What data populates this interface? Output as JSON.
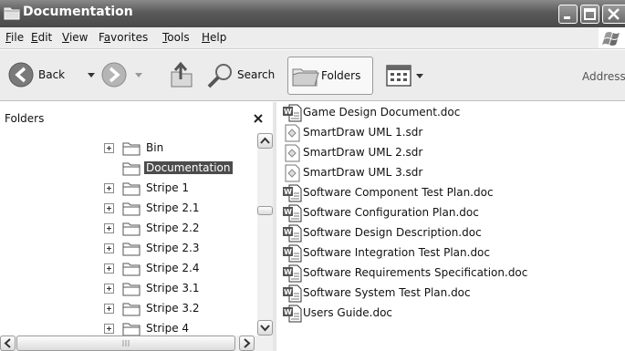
{
  "window": {
    "title": "Documentation"
  },
  "menu": [
    {
      "label": "File",
      "u": "F",
      "rest": "ile"
    },
    {
      "label": "Edit",
      "u": "E",
      "rest": "dit"
    },
    {
      "label": "View",
      "u": "V",
      "rest": "iew"
    },
    {
      "label": "Favorites",
      "pre": "F",
      "u": "a",
      "rest": "vorites"
    },
    {
      "label": "Tools",
      "u": "T",
      "rest": "ools"
    },
    {
      "label": "Help",
      "u": "H",
      "rest": "elp"
    }
  ],
  "toolbar": {
    "back_label": "Back",
    "search_label": "Search",
    "folders_label": "Folders",
    "address_label": "Address"
  },
  "folder_pane": {
    "header": "Folders",
    "items": [
      {
        "label": "Bin",
        "expandable": true,
        "selected": false
      },
      {
        "label": "Documentation",
        "expandable": false,
        "selected": true
      },
      {
        "label": "Stripe 1",
        "expandable": true,
        "selected": false
      },
      {
        "label": "Stripe 2.1",
        "expandable": true,
        "selected": false
      },
      {
        "label": "Stripe 2.2",
        "expandable": true,
        "selected": false
      },
      {
        "label": "Stripe 2.3",
        "expandable": true,
        "selected": false
      },
      {
        "label": "Stripe 2.4",
        "expandable": true,
        "selected": false
      },
      {
        "label": "Stripe 3.1",
        "expandable": true,
        "selected": false
      },
      {
        "label": "Stripe 3.2",
        "expandable": true,
        "selected": false
      },
      {
        "label": "Stripe 4",
        "expandable": true,
        "selected": false
      }
    ]
  },
  "files": [
    {
      "name": "Game Design Document.doc",
      "icon": "word-doc-icon"
    },
    {
      "name": "SmartDraw UML 1.sdr",
      "icon": "smartdraw-icon"
    },
    {
      "name": "SmartDraw UML 2.sdr",
      "icon": "smartdraw-icon"
    },
    {
      "name": "SmartDraw UML 3.sdr",
      "icon": "smartdraw-icon"
    },
    {
      "name": "Software Component Test Plan.doc",
      "icon": "word-doc-icon"
    },
    {
      "name": "Software Configuration Plan.doc",
      "icon": "word-doc-icon"
    },
    {
      "name": "Software Design Description.doc",
      "icon": "word-doc-icon"
    },
    {
      "name": "Software Integration Test Plan.doc",
      "icon": "word-doc-icon"
    },
    {
      "name": "Software Requirements Specification.doc",
      "icon": "word-doc-icon"
    },
    {
      "name": "Software System Test Plan.doc",
      "icon": "word-doc-icon"
    },
    {
      "name": "Users Guide.doc",
      "icon": "word-doc-icon"
    }
  ]
}
